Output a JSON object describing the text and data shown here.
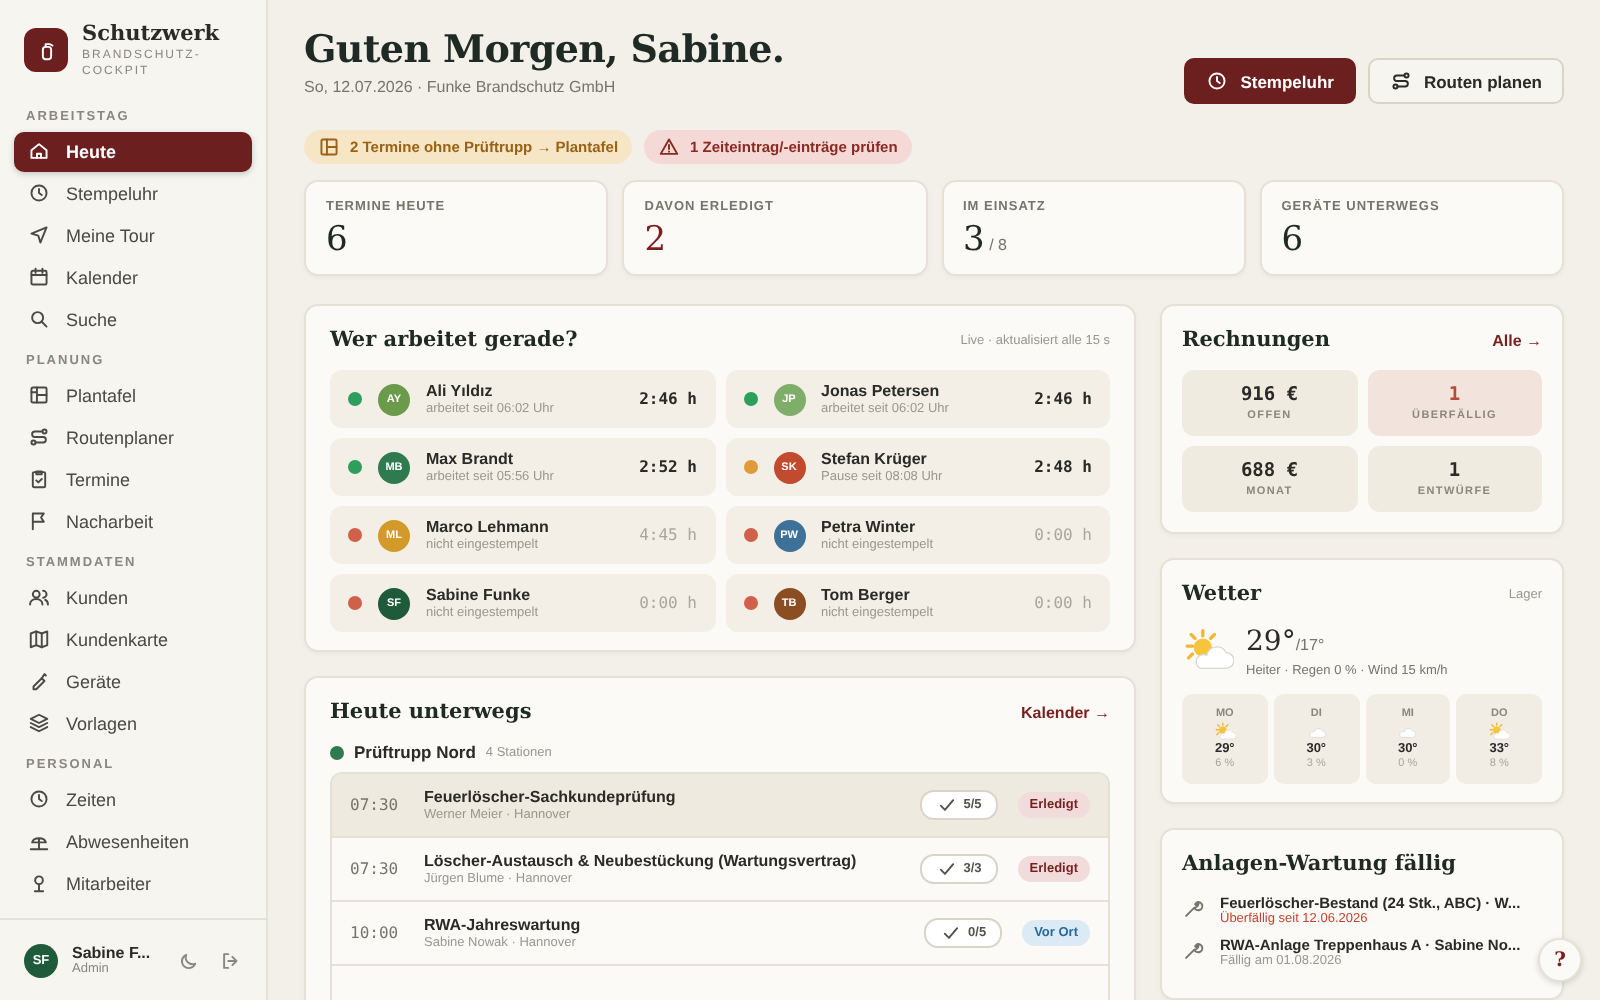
{
  "brand": {
    "name": "Schutzwerk",
    "tagline": "BRANDSCHUTZ-\nCOCKPIT"
  },
  "sidebar": {
    "sections": [
      {
        "title": "ARBEITSTAG",
        "items": [
          {
            "label": "Heute",
            "selected": true
          },
          {
            "label": "Stempeluhr",
            "selected": false
          },
          {
            "label": "Meine Tour",
            "selected": false
          },
          {
            "label": "Kalender",
            "selected": false
          },
          {
            "label": "Suche",
            "selected": false
          }
        ]
      },
      {
        "title": "PLANUNG",
        "items": [
          {
            "label": "Plantafel",
            "selected": false
          },
          {
            "label": "Routenplaner",
            "selected": false
          },
          {
            "label": "Termine",
            "selected": false
          },
          {
            "label": "Nacharbeit",
            "selected": false
          }
        ]
      },
      {
        "title": "STAMMDATEN",
        "items": [
          {
            "label": "Kunden",
            "selected": false
          },
          {
            "label": "Kundenkarte",
            "selected": false
          },
          {
            "label": "Geräte",
            "selected": false
          },
          {
            "label": "Vorlagen",
            "selected": false
          }
        ]
      },
      {
        "title": "PERSONAL",
        "items": [
          {
            "label": "Zeiten",
            "selected": false
          },
          {
            "label": "Abwesenheiten",
            "selected": false
          },
          {
            "label": "Mitarbeiter",
            "selected": false
          }
        ]
      }
    ],
    "user": {
      "initials": "SF",
      "name": "Sabine F...",
      "role": "Admin"
    }
  },
  "header": {
    "title": "Guten Morgen, Sabine.",
    "subtitle": "So, 12.07.2026 · Funke Brandschutz GmbH",
    "buttons": [
      {
        "label": "Stempeluhr",
        "kind": "primary"
      },
      {
        "label": "Routen planen",
        "kind": "secondary"
      }
    ]
  },
  "alerts": [
    {
      "text": "2 Termine ohne Prüftrupp → Plantafel",
      "kind": "warning"
    },
    {
      "text": "1 Zeiteintrag/-einträge prüfen",
      "kind": "error"
    }
  ],
  "stats": [
    {
      "label": "TERMINE HEUTE",
      "value": "6",
      "highlight": false
    },
    {
      "label": "DAVON ERLEDIGT",
      "value": "2",
      "highlight": true
    },
    {
      "label": "IM EINSATZ",
      "value": "3",
      "suffix": "/ 8",
      "highlight": false
    },
    {
      "label": "GERÄTE UNTERWEGS",
      "value": "6",
      "highlight": false
    }
  ],
  "workers": {
    "title": "Wer arbeitet gerade?",
    "note": "Live · aktualisiert alle 15 s",
    "items": [
      {
        "avatar": {
          "initials": "AY",
          "color": "#6a9a4a"
        },
        "name": "Ali Yıldız",
        "status": "arbeitet seit 06:02 Uhr",
        "time": "2:46 h",
        "color": "#2e9e5b",
        "active": true
      },
      {
        "avatar": {
          "initials": "JP",
          "color": "#7fae6a"
        },
        "name": "Jonas Petersen",
        "status": "arbeitet seit 06:02 Uhr",
        "time": "2:46 h",
        "color": "#2e9e5b",
        "active": true
      },
      {
        "avatar": {
          "initials": "MB",
          "color": "#2f7a4f"
        },
        "name": "Max Brandt",
        "status": "arbeitet seit 05:56 Uhr",
        "time": "2:52 h",
        "color": "#2e9e5b",
        "active": true
      },
      {
        "avatar": {
          "initials": "SK",
          "color": "#c24a2e"
        },
        "name": "Stefan Krüger",
        "status": "Pause seit 08:08 Uhr",
        "time": "2:48 h",
        "color": "#e09a3a",
        "active": true
      },
      {
        "avatar": {
          "initials": "ML",
          "color": "#d39a2a"
        },
        "name": "Marco Lehmann",
        "status": "nicht eingestempelt",
        "time": "4:45 h",
        "color": "#d0604a",
        "active": false
      },
      {
        "avatar": {
          "initials": "PW",
          "color": "#3f7098"
        },
        "name": "Petra Winter",
        "status": "nicht eingestempelt",
        "time": "0:00 h",
        "color": "#d0604a",
        "active": false
      },
      {
        "avatar": {
          "initials": "SF",
          "color": "#1f5a3a"
        },
        "name": "Sabine Funke",
        "status": "nicht eingestempelt",
        "time": "0:00 h",
        "color": "#d0604a",
        "active": false
      },
      {
        "avatar": {
          "initials": "TB",
          "color": "#8a4e22"
        },
        "name": "Tom Berger",
        "status": "nicht eingestempelt",
        "time": "0:00 h",
        "color": "#d0604a",
        "active": false
      }
    ]
  },
  "tour": {
    "title": "Heute unterwegs",
    "link": "Kalender →",
    "team": {
      "name": "Prüftrupp Nord",
      "count": "4 Stationen",
      "color": "#2f7a4f"
    },
    "jobs": [
      {
        "time": "07:30",
        "title": "Feuerlöscher-Sachkundeprüfung",
        "subtitle": "Werner Meier · Hannover",
        "check": "5/5",
        "status": "Erledigt",
        "kind": "done",
        "selected": true
      },
      {
        "time": "07:30",
        "title": "Löscher-Austausch & Neubestückung (Wartungsvertrag)",
        "subtitle": "Jürgen Blume · Hannover",
        "check": "3/3",
        "status": "Erledigt",
        "kind": "done",
        "selected": false
      },
      {
        "time": "10:00",
        "title": "RWA-Jahreswartung",
        "subtitle": "Sabine Nowak · Hannover",
        "check": "0/5",
        "status": "Vor Ort",
        "kind": "onsite",
        "selected": false
      }
    ]
  },
  "invoices": {
    "title": "Rechnungen",
    "link": "Alle →",
    "tiles": [
      {
        "value": "916 €",
        "label": "OFFEN",
        "alert": false
      },
      {
        "value": "1",
        "label": "ÜBERFÄLLIG",
        "alert": true
      },
      {
        "value": "688 €",
        "label": "MONAT",
        "alert": false
      },
      {
        "value": "1",
        "label": "ENTWÜRFE",
        "alert": false
      }
    ]
  },
  "weather": {
    "title": "Wetter",
    "location": "Lager",
    "temp": "29°",
    "low": "/17°",
    "summary": "Heiter · Regen 0 % · Wind 15 km/h",
    "days": [
      {
        "day": "MO",
        "kind": "sun_cloud",
        "temp": "29°",
        "rain": "6 %"
      },
      {
        "day": "DI",
        "kind": "cloud",
        "temp": "30°",
        "rain": "3 %"
      },
      {
        "day": "MI",
        "kind": "cloud",
        "temp": "30°",
        "rain": "0 %"
      },
      {
        "day": "DO",
        "kind": "sun_cloud",
        "temp": "33°",
        "rain": "8 %"
      }
    ]
  },
  "maintenance": {
    "title": "Anlagen-Wartung fällig",
    "items": [
      {
        "title": "Feuerlöscher-Bestand (24 Stk., ABC) · W...",
        "due": "Überfällig seit 12.06.2026",
        "overdue": true
      },
      {
        "title": "RWA-Anlage Treppenhaus A · Sabine No...",
        "due": "Fällig am 01.08.2026",
        "overdue": false
      }
    ]
  },
  "help": {
    "label": "?"
  }
}
